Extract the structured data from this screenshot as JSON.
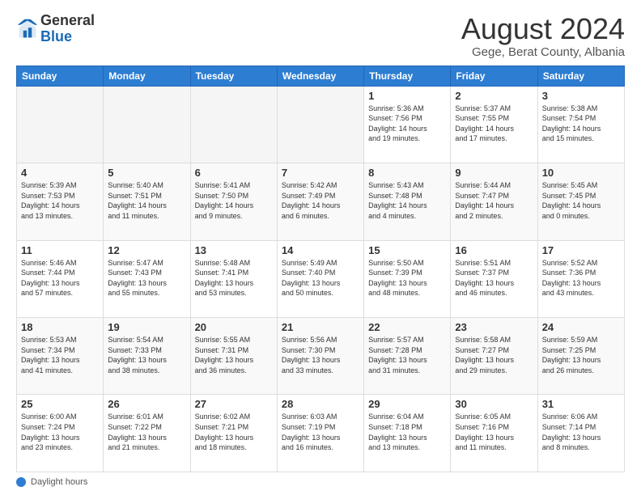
{
  "header": {
    "logo_general": "General",
    "logo_blue": "Blue",
    "main_title": "August 2024",
    "subtitle": "Gege, Berat County, Albania"
  },
  "weekdays": [
    "Sunday",
    "Monday",
    "Tuesday",
    "Wednesday",
    "Thursday",
    "Friday",
    "Saturday"
  ],
  "footer_label": "Daylight hours",
  "weeks": [
    [
      {
        "day": "",
        "info": ""
      },
      {
        "day": "",
        "info": ""
      },
      {
        "day": "",
        "info": ""
      },
      {
        "day": "",
        "info": ""
      },
      {
        "day": "1",
        "info": "Sunrise: 5:36 AM\nSunset: 7:56 PM\nDaylight: 14 hours\nand 19 minutes."
      },
      {
        "day": "2",
        "info": "Sunrise: 5:37 AM\nSunset: 7:55 PM\nDaylight: 14 hours\nand 17 minutes."
      },
      {
        "day": "3",
        "info": "Sunrise: 5:38 AM\nSunset: 7:54 PM\nDaylight: 14 hours\nand 15 minutes."
      }
    ],
    [
      {
        "day": "4",
        "info": "Sunrise: 5:39 AM\nSunset: 7:53 PM\nDaylight: 14 hours\nand 13 minutes."
      },
      {
        "day": "5",
        "info": "Sunrise: 5:40 AM\nSunset: 7:51 PM\nDaylight: 14 hours\nand 11 minutes."
      },
      {
        "day": "6",
        "info": "Sunrise: 5:41 AM\nSunset: 7:50 PM\nDaylight: 14 hours\nand 9 minutes."
      },
      {
        "day": "7",
        "info": "Sunrise: 5:42 AM\nSunset: 7:49 PM\nDaylight: 14 hours\nand 6 minutes."
      },
      {
        "day": "8",
        "info": "Sunrise: 5:43 AM\nSunset: 7:48 PM\nDaylight: 14 hours\nand 4 minutes."
      },
      {
        "day": "9",
        "info": "Sunrise: 5:44 AM\nSunset: 7:47 PM\nDaylight: 14 hours\nand 2 minutes."
      },
      {
        "day": "10",
        "info": "Sunrise: 5:45 AM\nSunset: 7:45 PM\nDaylight: 14 hours\nand 0 minutes."
      }
    ],
    [
      {
        "day": "11",
        "info": "Sunrise: 5:46 AM\nSunset: 7:44 PM\nDaylight: 13 hours\nand 57 minutes."
      },
      {
        "day": "12",
        "info": "Sunrise: 5:47 AM\nSunset: 7:43 PM\nDaylight: 13 hours\nand 55 minutes."
      },
      {
        "day": "13",
        "info": "Sunrise: 5:48 AM\nSunset: 7:41 PM\nDaylight: 13 hours\nand 53 minutes."
      },
      {
        "day": "14",
        "info": "Sunrise: 5:49 AM\nSunset: 7:40 PM\nDaylight: 13 hours\nand 50 minutes."
      },
      {
        "day": "15",
        "info": "Sunrise: 5:50 AM\nSunset: 7:39 PM\nDaylight: 13 hours\nand 48 minutes."
      },
      {
        "day": "16",
        "info": "Sunrise: 5:51 AM\nSunset: 7:37 PM\nDaylight: 13 hours\nand 46 minutes."
      },
      {
        "day": "17",
        "info": "Sunrise: 5:52 AM\nSunset: 7:36 PM\nDaylight: 13 hours\nand 43 minutes."
      }
    ],
    [
      {
        "day": "18",
        "info": "Sunrise: 5:53 AM\nSunset: 7:34 PM\nDaylight: 13 hours\nand 41 minutes."
      },
      {
        "day": "19",
        "info": "Sunrise: 5:54 AM\nSunset: 7:33 PM\nDaylight: 13 hours\nand 38 minutes."
      },
      {
        "day": "20",
        "info": "Sunrise: 5:55 AM\nSunset: 7:31 PM\nDaylight: 13 hours\nand 36 minutes."
      },
      {
        "day": "21",
        "info": "Sunrise: 5:56 AM\nSunset: 7:30 PM\nDaylight: 13 hours\nand 33 minutes."
      },
      {
        "day": "22",
        "info": "Sunrise: 5:57 AM\nSunset: 7:28 PM\nDaylight: 13 hours\nand 31 minutes."
      },
      {
        "day": "23",
        "info": "Sunrise: 5:58 AM\nSunset: 7:27 PM\nDaylight: 13 hours\nand 29 minutes."
      },
      {
        "day": "24",
        "info": "Sunrise: 5:59 AM\nSunset: 7:25 PM\nDaylight: 13 hours\nand 26 minutes."
      }
    ],
    [
      {
        "day": "25",
        "info": "Sunrise: 6:00 AM\nSunset: 7:24 PM\nDaylight: 13 hours\nand 23 minutes."
      },
      {
        "day": "26",
        "info": "Sunrise: 6:01 AM\nSunset: 7:22 PM\nDaylight: 13 hours\nand 21 minutes."
      },
      {
        "day": "27",
        "info": "Sunrise: 6:02 AM\nSunset: 7:21 PM\nDaylight: 13 hours\nand 18 minutes."
      },
      {
        "day": "28",
        "info": "Sunrise: 6:03 AM\nSunset: 7:19 PM\nDaylight: 13 hours\nand 16 minutes."
      },
      {
        "day": "29",
        "info": "Sunrise: 6:04 AM\nSunset: 7:18 PM\nDaylight: 13 hours\nand 13 minutes."
      },
      {
        "day": "30",
        "info": "Sunrise: 6:05 AM\nSunset: 7:16 PM\nDaylight: 13 hours\nand 11 minutes."
      },
      {
        "day": "31",
        "info": "Sunrise: 6:06 AM\nSunset: 7:14 PM\nDaylight: 13 hours\nand 8 minutes."
      }
    ]
  ]
}
